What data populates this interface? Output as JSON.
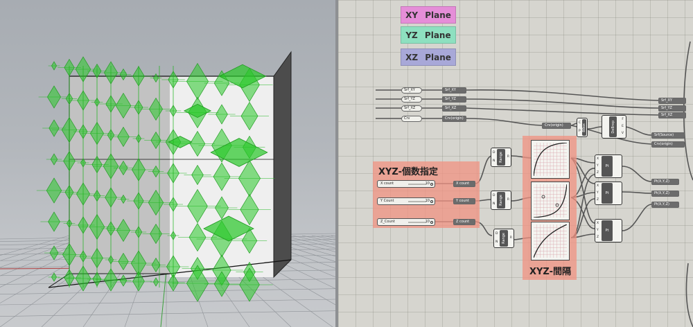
{
  "planes": [
    {
      "label": "XY Plane",
      "color": "#e58ed8"
    },
    {
      "label": "YZ Plane",
      "color": "#8ee0c0"
    },
    {
      "label": "XZ Plane",
      "color": "#a8a8d8"
    }
  ],
  "left_params": [
    "Srf_XY",
    "Srf_YZ",
    "Srf_XZ",
    "Crv"
  ],
  "relay_params": [
    "Srf_XY",
    "Srf_YZ",
    "Srf_XZ",
    "Crv(origin)"
  ],
  "bbox": {
    "label": "BBox",
    "inputs": [
      "C",
      "P"
    ],
    "outputs": [
      "B",
      "B"
    ]
  },
  "deconstruct": {
    "label": "DeBrep",
    "outputs": [
      "F",
      "E",
      "V"
    ]
  },
  "right_params": [
    "Srf_XY",
    "Srf_YZ",
    "Srf_XZ",
    "Crv(origin)",
    "Srf(Source)",
    "Crv(origin)"
  ],
  "group_count": {
    "title": "XYZ-個数指定"
  },
  "group_spacing": {
    "title": "XYZ-間隔"
  },
  "sliders": [
    {
      "label": "X count",
      "value": "10",
      "out": "X count"
    },
    {
      "label": "Y Count",
      "value": "10",
      "out": "Y count"
    },
    {
      "label": "Z_Count",
      "value": "10",
      "out": "Z count"
    }
  ],
  "range": {
    "label": "Range",
    "inputs": [
      "D",
      "N"
    ],
    "output": "R"
  },
  "point": {
    "label": "Pt",
    "inputs": [
      "X",
      "Y",
      "Z"
    ]
  },
  "out_params": [
    "Pt(X,Y,Z)",
    "Pt(X,Y,Z)",
    "Pt(X,Y,Z)"
  ]
}
